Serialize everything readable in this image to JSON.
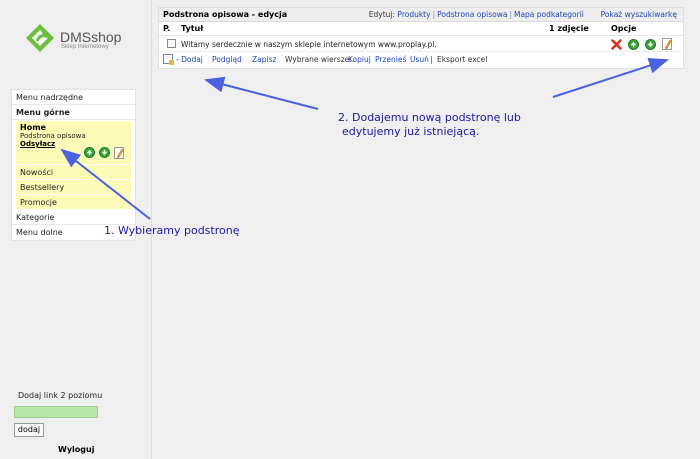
{
  "logo": {
    "name": "DMSshop",
    "tagline": "Sklep Internetowy"
  },
  "sidebar": {
    "menu_nadrzedne": "Menu nadrzędne",
    "menu_gorne": "Menu górne",
    "home": {
      "title": "Home",
      "subtitle": "Podstrona opisowa",
      "link": "Odsyłacz"
    },
    "sub_items": [
      "Nowości",
      "Bestsellery",
      "Promocje"
    ],
    "kategorie": "Kategorie",
    "menu_dolne": "Menu dolne",
    "add_label": "Dodaj link 2 poziomu",
    "add_input_value": "",
    "add_button": "dodaj",
    "logout": "Wyloguj"
  },
  "panel": {
    "title": "Podstrona opisowa - edycja",
    "edit_prefix": "Edytuj:",
    "edit_links": [
      "Produkty",
      "Podstrona opisowa",
      "Mapa podkategorii"
    ],
    "show_search": "Pokaż wyszukiwarkę",
    "columns": {
      "p": "P.",
      "title": "Tytuł",
      "photo": "1 zdjęcie",
      "options": "Opcje"
    },
    "rows": [
      {
        "title": "Witamy serdecznie w naszym sklepie internetowym www.proplay.pl."
      }
    ],
    "toolbar": {
      "add": "- Dodaj",
      "preview": "Podgląd",
      "save": "Zapisz",
      "selected_rows": "Wybrane wiersze:",
      "copy": "Kopiuj",
      "move": "Przenieś",
      "delete": "Usuń",
      "export": "Eksport excel"
    }
  },
  "annotations": {
    "step1": "1. Wybieramy podstronę",
    "step2_line1": "2. Dodajemu nową podstronę lub",
    "step2_line2": "edytujemy już istniejącą."
  },
  "colors": {
    "link": "#1f44b0",
    "annotation": "#1919a0",
    "highlight": "#fbfbb7",
    "icon_green": "#3aa43a",
    "delete_red": "#e02a1a"
  },
  "icons": [
    "logo-mark",
    "arrow-up-icon",
    "arrow-down-icon",
    "edit-icon",
    "delete-icon",
    "add-page-icon",
    "checkbox"
  ]
}
